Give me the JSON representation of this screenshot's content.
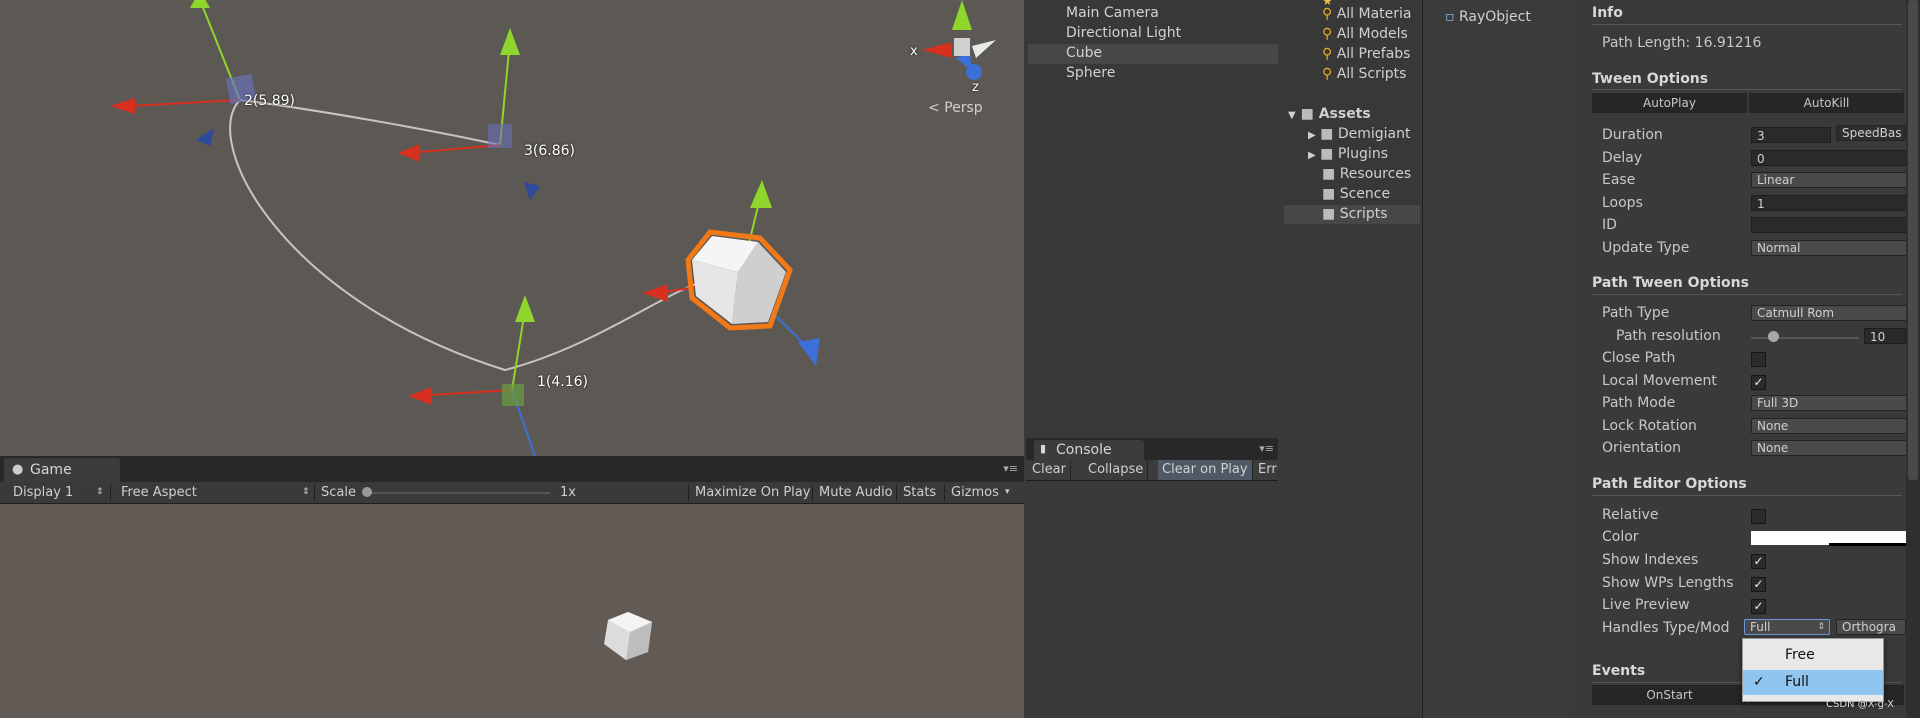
{
  "scene": {
    "waypoints": [
      {
        "label": "2(5.89)"
      },
      {
        "label": "3(6.86)"
      },
      {
        "label": "1(4.16)"
      }
    ],
    "gizmo": {
      "x_axis": "x",
      "z_axis": "z",
      "projection": "Persp"
    }
  },
  "game": {
    "tab_label": "Game",
    "display": "Display 1",
    "aspect": "Free Aspect",
    "scale_label": "Scale",
    "scale_value": "1x",
    "maximize_on_play": "Maximize On Play",
    "mute_audio": "Mute Audio",
    "stats": "Stats",
    "gizmos": "Gizmos"
  },
  "hierarchy": {
    "items": [
      "Main Camera",
      "Directional Light",
      "Cube",
      "Sphere"
    ],
    "selected": "Cube"
  },
  "console": {
    "tab_label": "Console",
    "buttons": [
      "Clear",
      "Collapse",
      "Clear on Play",
      "Err"
    ]
  },
  "project": {
    "favorites": [
      "All Materia",
      "All Models",
      "All Prefabs",
      "All Scripts"
    ],
    "assets_label": "Assets",
    "folders": [
      "Demigiant",
      "Plugins",
      "Resources",
      "Scence",
      "Scripts"
    ],
    "selected_folder": "Scripts",
    "files": [
      "RayObject"
    ]
  },
  "inspector": {
    "info_title": "Info",
    "path_length": "Path Length: 16.91216",
    "tween_title": "Tween Options",
    "autoplay": "AutoPlay",
    "autokill": "AutoKill",
    "duration_label": "Duration",
    "duration_value": "3",
    "speedbased": "SpeedBas",
    "delay_label": "Delay",
    "delay_value": "0",
    "ease_label": "Ease",
    "ease_value": "Linear",
    "loops_label": "Loops",
    "loops_value": "1",
    "id_label": "ID",
    "id_value": "",
    "update_label": "Update Type",
    "update_value": "Normal",
    "path_tween_title": "Path Tween Options",
    "path_type_label": "Path Type",
    "path_type_value": "Catmull Rom",
    "path_res_label": "Path resolution",
    "path_res_value": "10",
    "path_res_fraction": 0.2,
    "close_path_label": "Close Path",
    "local_move_label": "Local Movement",
    "path_mode_label": "Path Mode",
    "path_mode_value": "Full 3D",
    "lock_rot_label": "Lock Rotation",
    "lock_rot_value": "None",
    "orientation_label": "Orientation",
    "orientation_value": "None",
    "editor_title": "Path Editor Options",
    "relative_label": "Relative",
    "color_label": "Color",
    "show_indexes_label": "Show Indexes",
    "show_wps_label": "Show WPs Lengths",
    "live_preview_label": "Live Preview",
    "handles_label": "Handles Type/Mod",
    "handles_value": "Full",
    "handles_second": "Orthogra",
    "events_title": "Events",
    "onstart": "OnStart",
    "watermark": "CSDN @X-g-X"
  },
  "popup": {
    "options": [
      "Free",
      "Full"
    ],
    "selected": "Full"
  },
  "colors": {
    "x_axis": "#d8301e",
    "y_axis": "#8ed62c",
    "z_axis": "#3d6fd8",
    "selection": "#f27a16",
    "popup_selected": "#8fc5ef"
  }
}
